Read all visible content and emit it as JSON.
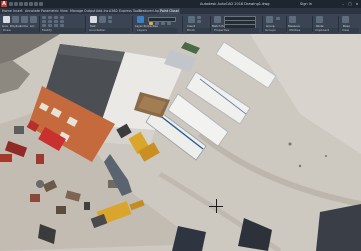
{
  "titlebar": {
    "app_badge": "A",
    "file_title": "Autodesk AutoCAD 2018   Drawing1.dwg",
    "sign_in": "Sign In"
  },
  "ribbon_tabs": [
    "Home",
    "Insert",
    "Annotate",
    "Parametric",
    "View",
    "Manage",
    "Output",
    "Add-ins",
    "A360",
    "Express Tools",
    "Featured Apps",
    "Point Cloud"
  ],
  "active_tab": "Point Cloud",
  "panels": {
    "draw": "Draw",
    "modify": "Modify",
    "annotation": "Annotation",
    "layers": "Layers",
    "block": "Block",
    "properties": "Properties",
    "groups": "Groups",
    "utilities": "Utilities",
    "clipboard": "Clipboard",
    "view": "View"
  },
  "ribbon_labels": {
    "line": "Line",
    "polyline": "Polyline",
    "circle": "Circle",
    "arc": "Arc",
    "text": "Text",
    "layer_properties": "Layer Properties",
    "insert": "Insert",
    "match_properties": "Match Properties",
    "group": "Group",
    "measure": "Measure",
    "paste": "Paste",
    "base": "Base"
  },
  "colors": {
    "title_bar": "#1c2530",
    "ribbon_bg": "#3a4452",
    "canvas_bg": "#cfcbc4",
    "active_button": "#3f7fc4",
    "orange_roof": "#c46a3c",
    "red_truck": "#c8312e"
  }
}
